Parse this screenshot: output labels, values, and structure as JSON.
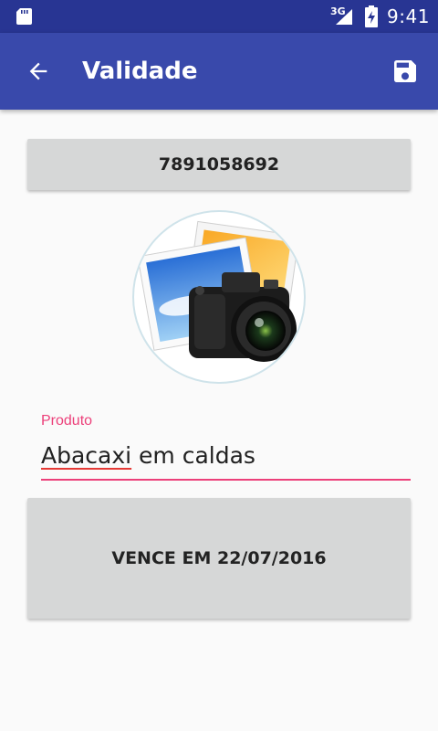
{
  "status_bar": {
    "network": "3G",
    "time": "9:41"
  },
  "app_bar": {
    "title": "Validade",
    "back_icon": "arrow-back-icon",
    "save_icon": "save-icon"
  },
  "barcode_button": {
    "label": "7891058692"
  },
  "product_photo": {
    "icon": "camera-photo-icon"
  },
  "product_field": {
    "label": "Produto",
    "value_misspelled": "Abacaxi",
    "value_rest": " em caldas"
  },
  "expiry_button": {
    "label": "VENCE EM 22/07/2016"
  },
  "colors": {
    "status_bar": "#283593",
    "app_bar": "#3949ab",
    "accent": "#ec407a",
    "button": "#d6d7d7"
  }
}
